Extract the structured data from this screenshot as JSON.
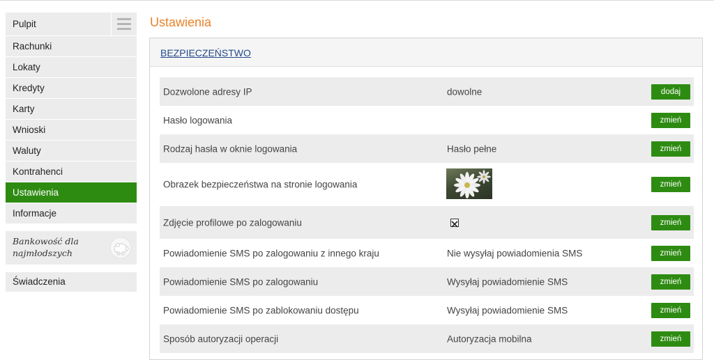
{
  "sidebar": {
    "items": [
      {
        "label": "Pulpit",
        "active": false
      },
      {
        "label": "Rachunki",
        "active": false
      },
      {
        "label": "Lokaty",
        "active": false
      },
      {
        "label": "Kredyty",
        "active": false
      },
      {
        "label": "Karty",
        "active": false
      },
      {
        "label": "Wnioski",
        "active": false
      },
      {
        "label": "Waluty",
        "active": false
      },
      {
        "label": "Kontrahenci",
        "active": false
      },
      {
        "label": "Ustawienia",
        "active": true
      },
      {
        "label": "Informacje",
        "active": false
      }
    ],
    "menu_icon": "hamburger-icon",
    "promo": {
      "text": "Bankowość dla najmłodszych",
      "icon": "piggy-bank-icon"
    },
    "benefits_label": "Świadczenia"
  },
  "main": {
    "title": "Ustawienia",
    "section_title": "BEZPIECZEŃSTWO",
    "rows": [
      {
        "label": "Dozwolone adresy IP",
        "value": "dowolne",
        "button": "dodaj"
      },
      {
        "label": "Hasło logowania",
        "value": "",
        "button": "zmień"
      },
      {
        "label": "Rodzaj hasła w oknie logowania",
        "value": "Hasło pełne",
        "button": "zmień"
      },
      {
        "label": "Obrazek bezpieczeństwa na stronie logowania",
        "value": "",
        "button": "zmień",
        "image": "daisy-flower-image"
      },
      {
        "label": "Zdjęcie profilowe po zalogowaniu",
        "value": "",
        "button": "zmień",
        "image": "broken-image-icon"
      },
      {
        "label": "Powiadomienie SMS po zalogowaniu z innego kraju",
        "value": "Nie wysyłaj powiadomienia SMS",
        "button": "zmień"
      },
      {
        "label": "Powiadomienie SMS po zalogowaniu",
        "value": "Wysyłaj powiadomienie SMS",
        "button": "zmień"
      },
      {
        "label": "Powiadomienie SMS po zablokowaniu dostępu",
        "value": "Wysyłaj powiadomienie SMS",
        "button": "zmień"
      },
      {
        "label": "Sposób autoryzacji operacji",
        "value": "Autoryzacja mobilna",
        "button": "zmień"
      }
    ]
  },
  "colors": {
    "accent_green": "#2e8b12",
    "title_orange": "#e8832a",
    "link_blue": "#244a8c",
    "row_gray": "#ececec"
  }
}
